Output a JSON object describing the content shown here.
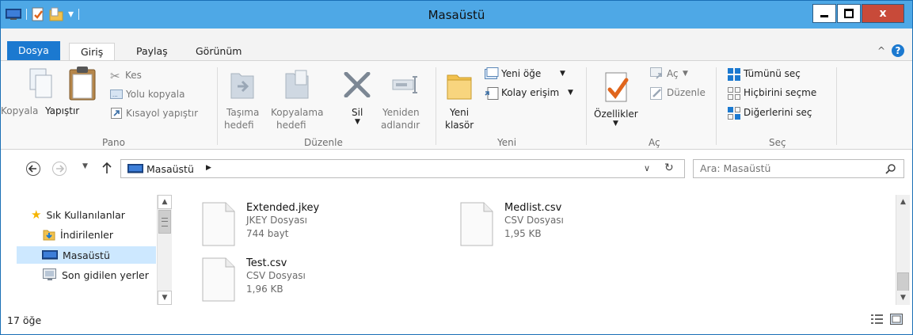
{
  "window": {
    "title": "Masaüstü",
    "controls": {
      "close_label": "x"
    }
  },
  "ribbon_tabs": {
    "file": "Dosya",
    "home": "Giriş",
    "share": "Paylaş",
    "view": "Görünüm"
  },
  "ribbon": {
    "clipboard": {
      "title": "Pano",
      "copy": "Kopyala",
      "paste": "Yapıştır",
      "cut": "Kes",
      "copy_path": "Yolu kopyala",
      "paste_shortcut": "Kısayol yapıştır"
    },
    "organize": {
      "title": "Düzenle",
      "move_to_line1": "Taşıma",
      "move_to_line2": "hedefi",
      "copy_to_line1": "Kopyalama",
      "copy_to_line2": "hedefi",
      "delete": "Sil",
      "rename_line1": "Yeniden",
      "rename_line2": "adlandır"
    },
    "new": {
      "title": "Yeni",
      "new_folder_line1": "Yeni",
      "new_folder_line2": "klasör",
      "new_item": "Yeni öğe",
      "easy_access": "Kolay erişim"
    },
    "open": {
      "title": "Aç",
      "properties": "Özellikler",
      "open": "Aç",
      "edit": "Düzenle"
    },
    "select": {
      "title": "Seç",
      "select_all": "Tümünü seç",
      "select_none": "Hiçbirini seçme",
      "invert": "Diğerlerini seç"
    }
  },
  "address_bar": {
    "path": "Masaüstü",
    "search_placeholder": "Ara: Masaüstü"
  },
  "nav_pane": {
    "items": [
      {
        "label": "Sık Kullanılanlar",
        "icon": "star-icon"
      },
      {
        "label": "İndirilenler",
        "icon": "downloads-folder-icon"
      },
      {
        "label": "Masaüstü",
        "icon": "desktop-icon",
        "selected": true
      },
      {
        "label": "Son gidilen yerler",
        "icon": "recent-places-icon"
      }
    ]
  },
  "files": [
    {
      "name": "Extended.jkey",
      "type": "JKEY Dosyası",
      "size": "744 bayt"
    },
    {
      "name": "Medlist.csv",
      "type": "CSV Dosyası",
      "size": "1,95 KB"
    },
    {
      "name": "Test.csv",
      "type": "CSV Dosyası",
      "size": "1,96 KB"
    }
  ],
  "status_bar": {
    "item_count": "17 öğe"
  },
  "colors": {
    "titlebar": "#4ea8e6",
    "file_tab": "#1b79d0",
    "close_button": "#c84a39",
    "selection": "#cde8ff"
  }
}
